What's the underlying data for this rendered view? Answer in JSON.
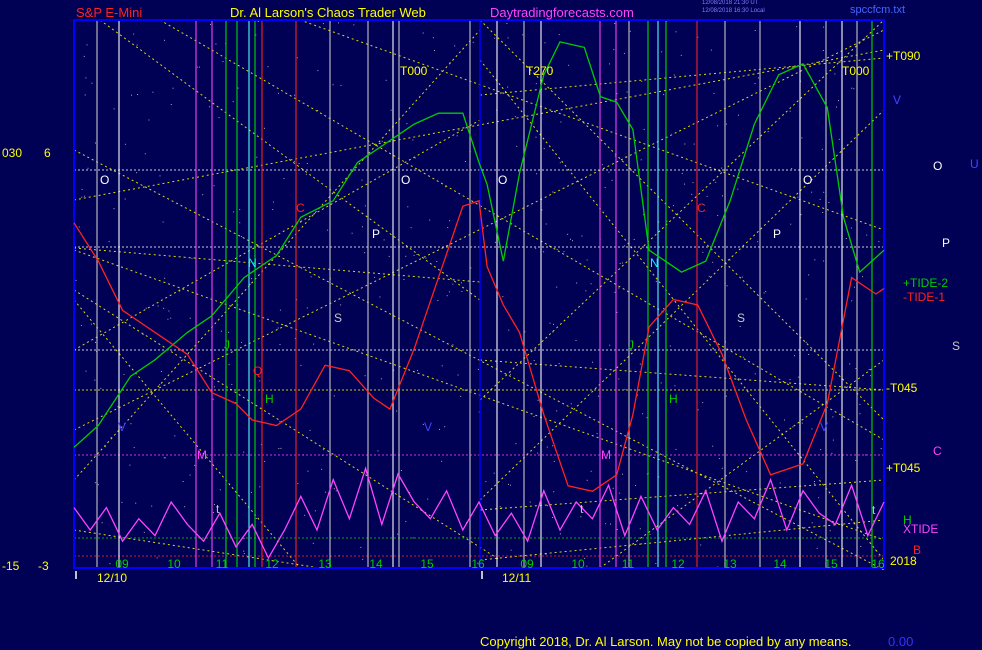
{
  "header": {
    "instrument": "S&P E-Mini",
    "author": "Dr. Al Larson's Chaos Trader Web",
    "site": "Daytradingforecasts.com",
    "stamp_line1": "12/08/2018 21:30 UT",
    "stamp_line2": "12/08/2018 16:30 Local",
    "file": "spccfcm.txt"
  },
  "footer": {
    "copyright": "Copyright 2018, Dr. Al Larson. May not be copied by any means.",
    "corner": "0.00"
  },
  "colors": {
    "background": "#000055",
    "plot_border": "#0000ff",
    "tide2": "#00cc00",
    "tide1": "#ff2222",
    "xtide": "#ff44ff",
    "fan": "#ffff00",
    "cycle_gray": "#c8c8c8",
    "cycle_cyan": "#55ffff",
    "cycle_green": "#00dd00",
    "cycle_red": "#ff2222",
    "cycle_magenta": "#ff44ff"
  },
  "chart_data": {
    "type": "line",
    "axes": {
      "left_outer_ticks": [
        "030",
        "-15"
      ],
      "left_inner_ticks": [
        "6",
        "-3"
      ]
    },
    "x_day_labels": [
      "09",
      "10",
      "11",
      "12",
      "13",
      "14",
      "15",
      "16",
      "09",
      "10",
      "11",
      "12",
      "13",
      "14",
      "15",
      "16"
    ],
    "x_date_labels": [
      "12/10",
      "12/11"
    ],
    "year_label": "2018",
    "right_labels": {
      "t090": "+T090",
      "tide2": "+TIDE-2",
      "tide1": "-TIDE-1",
      "mt045": "-T045",
      "pt045": "+T045",
      "h": "H",
      "xtide": "XTIDE",
      "b": "B"
    },
    "right_letters": [
      "V",
      "O",
      "U",
      "P",
      "S",
      "C"
    ],
    "top_labels": [
      "T000",
      "T270",
      "T000"
    ],
    "cycle_letters": {
      "day1": [
        "O",
        "V",
        "C",
        "N",
        "J",
        "H",
        "Q",
        "M",
        "t",
        "P",
        "S",
        "O",
        "V"
      ],
      "day2": [
        "O",
        "C",
        "N",
        "J",
        "H",
        "M",
        "t",
        "P",
        "S",
        "O",
        "V",
        "t"
      ]
    },
    "series": [
      {
        "name": "+TIDE-2",
        "x": [
          0,
          3,
          7,
          10,
          14,
          17,
          21,
          25,
          28,
          32,
          35,
          39,
          42,
          45,
          48,
          50,
          51,
          53,
          55,
          58,
          60,
          63,
          65,
          67,
          69,
          71,
          73,
          75,
          78,
          81,
          84,
          87,
          90,
          93,
          95,
          97,
          100
        ],
        "y": [
          0.78,
          0.74,
          0.65,
          0.62,
          0.57,
          0.54,
          0.47,
          0.43,
          0.36,
          0.33,
          0.26,
          0.22,
          0.19,
          0.17,
          0.17,
          0.26,
          0.3,
          0.44,
          0.28,
          0.1,
          0.04,
          0.05,
          0.14,
          0.15,
          0.2,
          0.42,
          0.44,
          0.46,
          0.44,
          0.33,
          0.19,
          0.1,
          0.08,
          0.16,
          0.36,
          0.46,
          0.42
        ]
      },
      {
        "name": "-TIDE-1",
        "x": [
          0,
          3,
          6,
          10,
          14,
          17,
          20,
          22,
          25,
          28,
          31,
          34,
          37,
          39,
          42,
          45,
          48,
          50,
          51,
          53,
          55,
          58,
          61,
          64,
          67,
          69,
          71,
          74,
          77,
          80,
          83,
          86,
          90,
          93,
          96,
          99,
          100
        ],
        "y": [
          0.37,
          0.44,
          0.53,
          0.57,
          0.61,
          0.68,
          0.7,
          0.73,
          0.74,
          0.71,
          0.63,
          0.64,
          0.69,
          0.71,
          0.6,
          0.47,
          0.34,
          0.33,
          0.45,
          0.52,
          0.57,
          0.72,
          0.85,
          0.86,
          0.83,
          0.72,
          0.56,
          0.51,
          0.52,
          0.61,
          0.73,
          0.83,
          0.81,
          0.7,
          0.47,
          0.5,
          0.49
        ]
      },
      {
        "name": "XTIDE",
        "x": [
          0,
          2,
          4,
          6,
          8,
          10,
          12,
          14,
          16,
          18,
          20,
          22,
          24,
          26,
          28,
          30,
          32,
          34,
          36,
          38,
          40,
          42,
          44,
          46,
          48,
          50,
          52,
          54,
          56,
          58,
          60,
          62,
          64,
          66,
          68,
          70,
          72,
          74,
          76,
          78,
          80,
          82,
          84,
          86,
          88,
          90,
          92,
          94,
          96,
          98,
          100
        ],
        "y": [
          0.09,
          0.05,
          0.09,
          0.03,
          0.07,
          0.04,
          0.1,
          0.06,
          0.03,
          0.08,
          0.02,
          0.06,
          0.0,
          0.05,
          0.11,
          0.05,
          0.14,
          0.07,
          0.16,
          0.06,
          0.15,
          0.1,
          0.07,
          0.12,
          0.05,
          0.1,
          0.04,
          0.08,
          0.03,
          0.12,
          0.05,
          0.1,
          0.07,
          0.13,
          0.04,
          0.11,
          0.05,
          0.09,
          0.06,
          0.12,
          0.03,
          0.1,
          0.07,
          0.14,
          0.05,
          0.12,
          0.08,
          0.06,
          0.13,
          0.04,
          0.1
        ]
      }
    ]
  }
}
